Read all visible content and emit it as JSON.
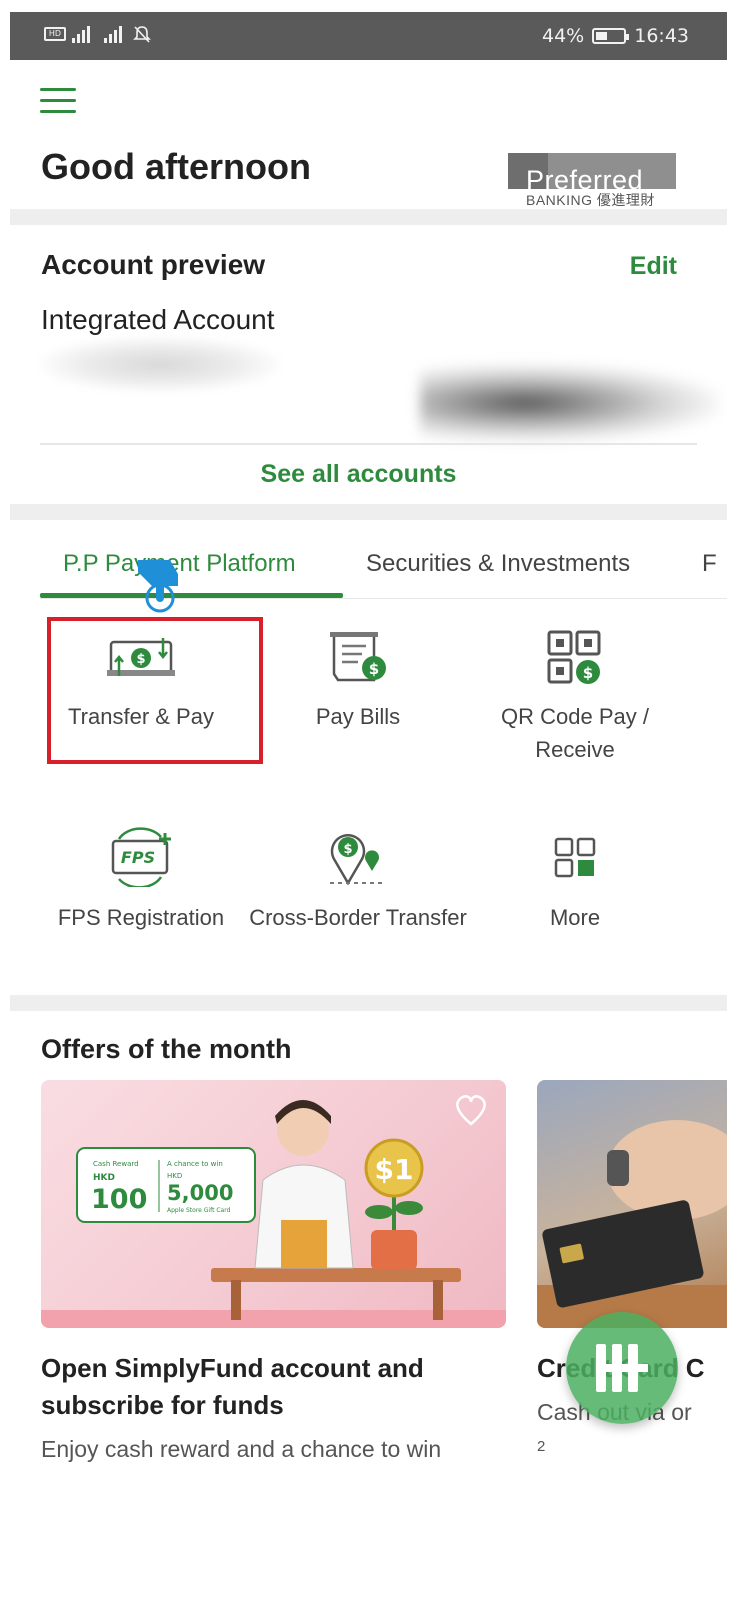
{
  "status_bar": {
    "left_text": "HD",
    "battery": "44%",
    "battery_level": 0.44,
    "time": "16:43"
  },
  "header": {
    "greeting": "Good afternoon",
    "badge_line1": "Preferred",
    "badge_line2": "BANKING 優進理財"
  },
  "account_preview": {
    "title": "Account preview",
    "edit_label": "Edit",
    "account_name": "Integrated Account",
    "see_all_label": "See all accounts"
  },
  "tabs": [
    {
      "label": "P.P Payment Platform",
      "active": true
    },
    {
      "label": "Securities & Investments",
      "active": false
    },
    {
      "label": "F",
      "active": false
    }
  ],
  "services": [
    {
      "label": "Transfer & Pay",
      "icon": "transfer-pay-icon"
    },
    {
      "label": "Pay Bills",
      "icon": "pay-bills-icon"
    },
    {
      "label": "QR Code Pay / Receive",
      "icon": "qr-code-icon"
    },
    {
      "label": "FPS Registration",
      "icon": "fps-registration-icon",
      "icon_text": "FPS"
    },
    {
      "label": "Cross-Border Transfer",
      "icon": "cross-border-icon"
    },
    {
      "label": "More",
      "icon": "more-grid-icon"
    }
  ],
  "offers": {
    "title": "Offers of the month",
    "items": [
      {
        "title": "Open SimplyFund account and subscribe for funds",
        "subtitle": "Enjoy cash reward and a chance to win",
        "promo": {
          "reward_label": "Cash Reward",
          "reward_currency": "HKD",
          "reward_amount": "100",
          "chance_label": "A chance to win",
          "chance_currency": "HKD",
          "chance_amount": "5,000",
          "chance_note": "Apple Store Gift Card",
          "coin_text": "$1"
        }
      },
      {
        "title": "Credit Card C",
        "subtitle": "Cash out via or",
        "footnote": "2"
      }
    ]
  },
  "colors": {
    "brand_green": "#2e8b3e",
    "highlight_red": "#d8202a",
    "status_bar": "#5a5a5a"
  }
}
